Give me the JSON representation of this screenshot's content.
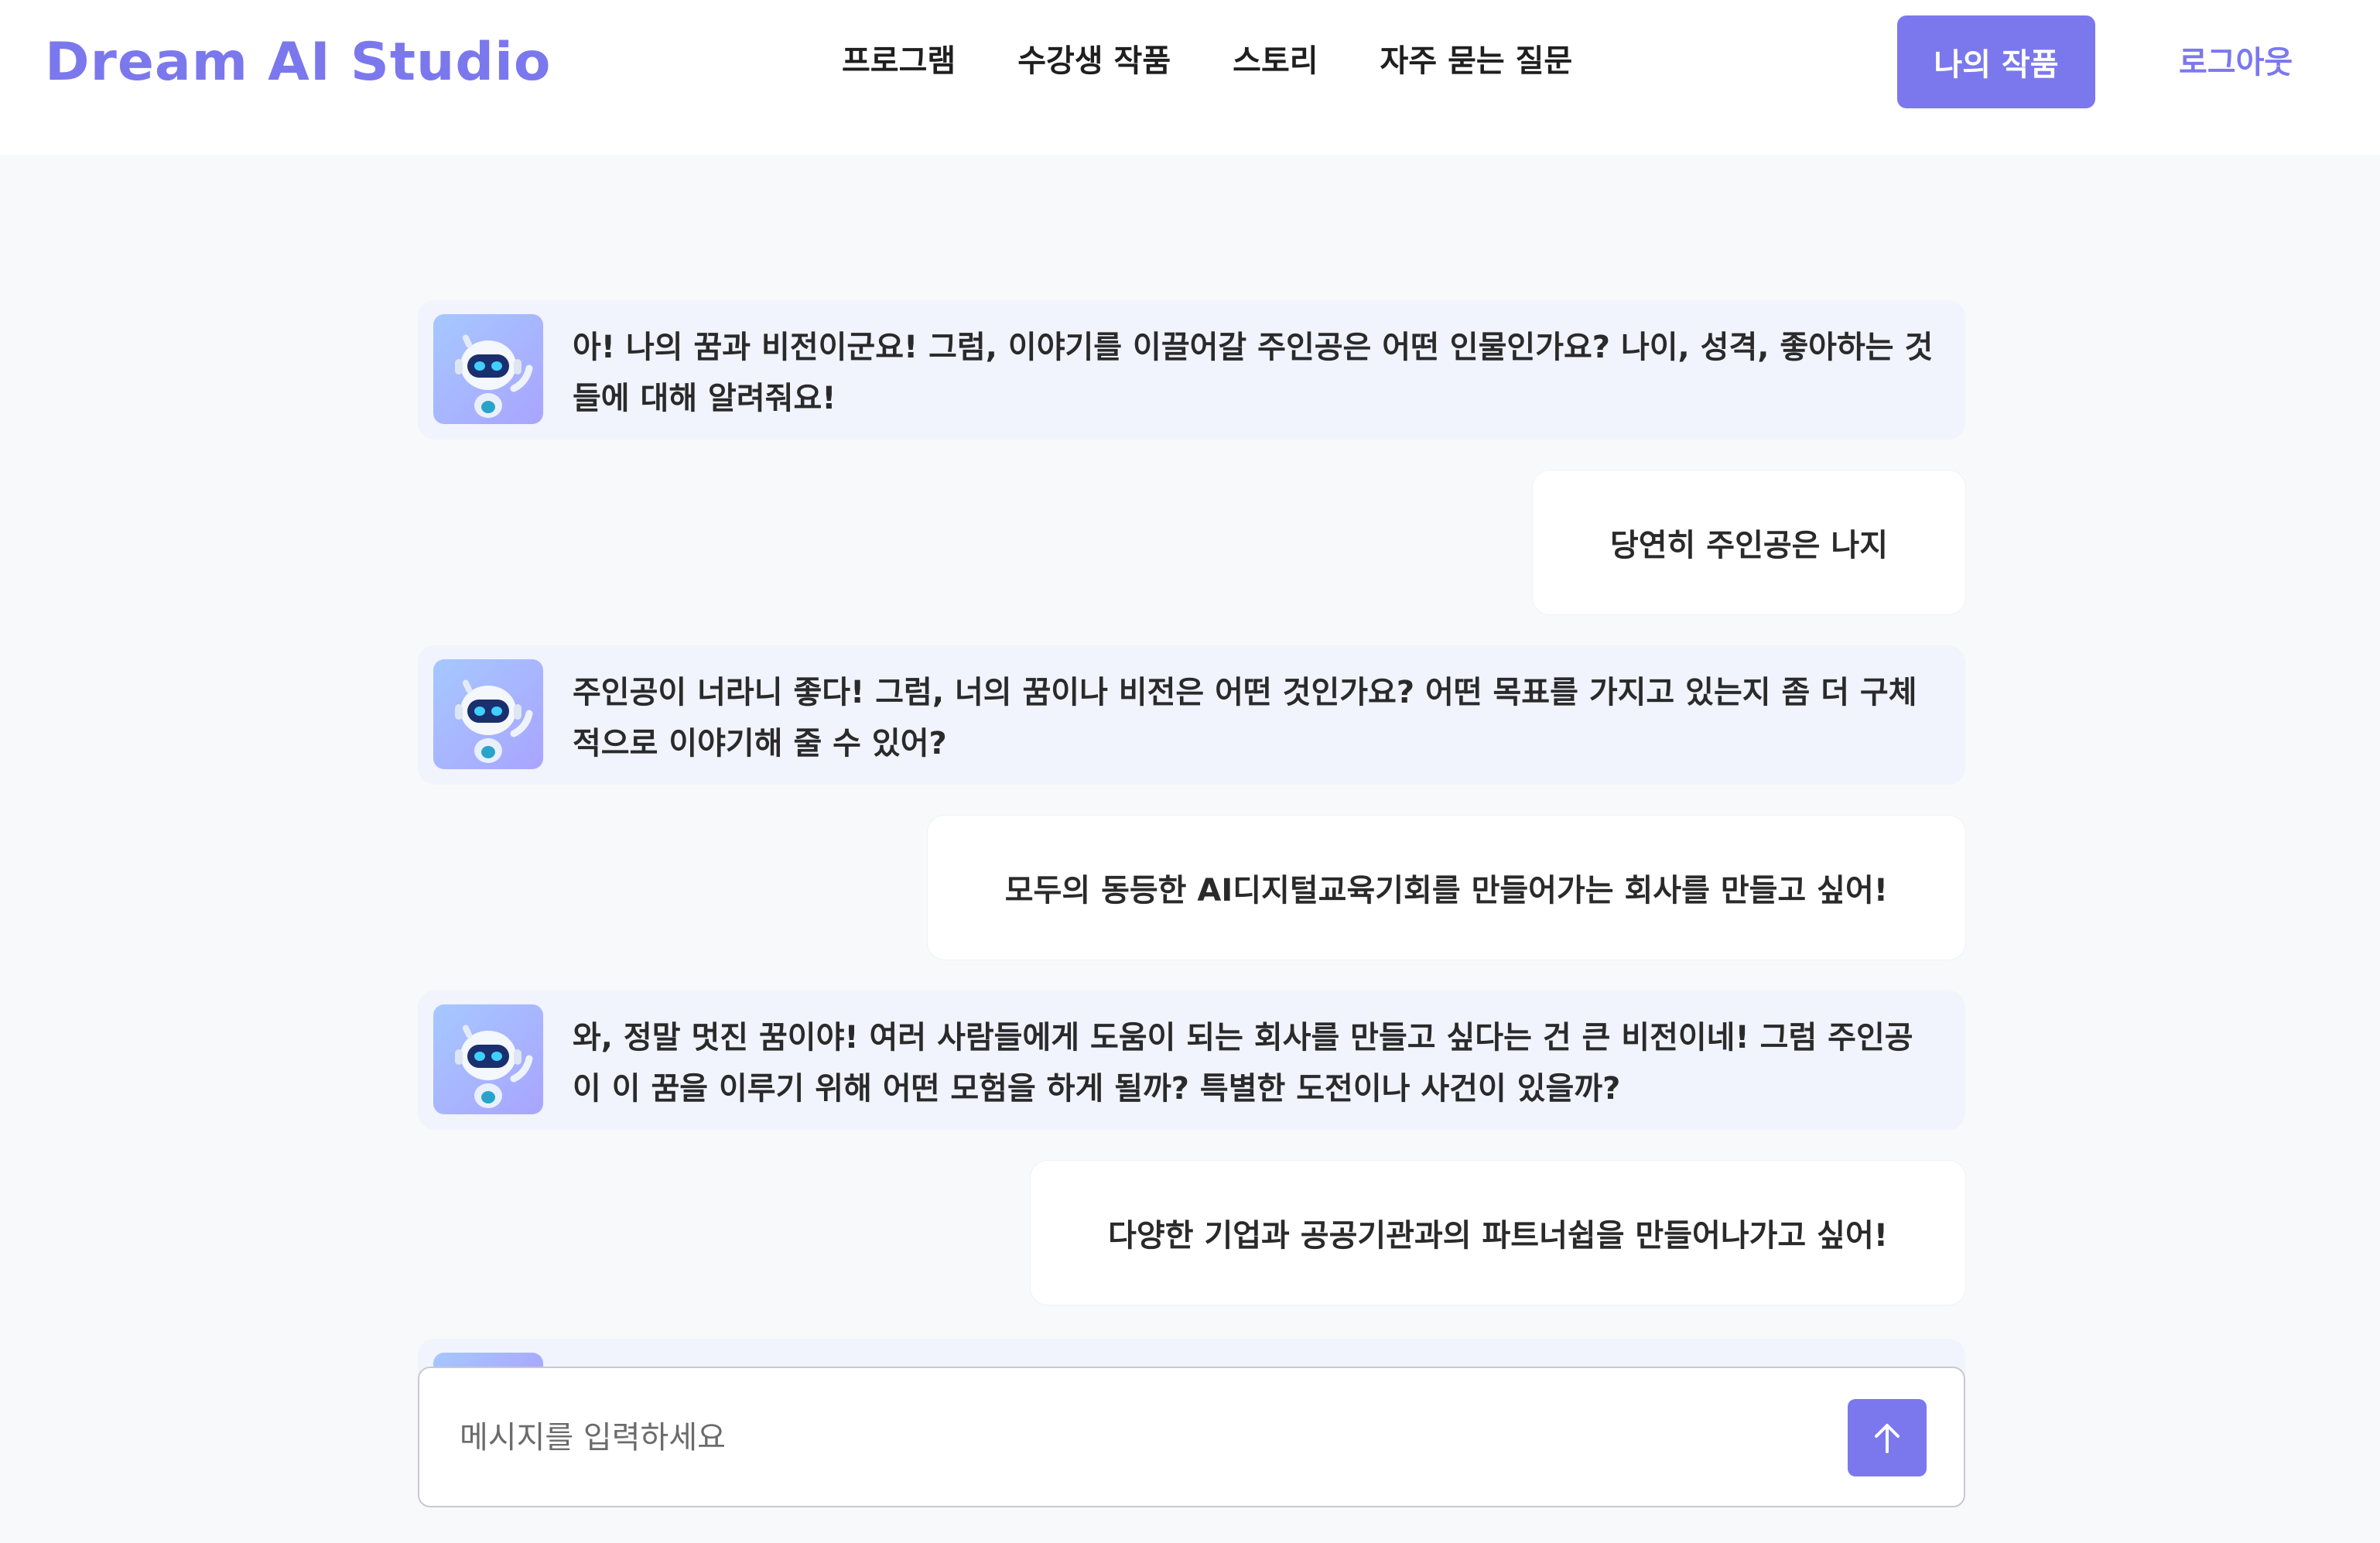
{
  "header": {
    "logo": "Dream AI Studio",
    "nav": [
      {
        "label": "프로그램"
      },
      {
        "label": "수강생 작품"
      },
      {
        "label": "스토리"
      },
      {
        "label": "자주 묻는 질문"
      }
    ],
    "my_works_label": "나의 작품",
    "logout_label": "로그아웃"
  },
  "chat": {
    "messages": [
      {
        "role": "bot",
        "text": "아! 나의 꿈과 비전이군요! 그럼, 이야기를 이끌어갈 주인공은 어떤 인물인가요? 나이, 성격, 좋아하는 것들에 대해 알려줘요!"
      },
      {
        "role": "user",
        "text": "당연히 주인공은 나지"
      },
      {
        "role": "bot",
        "text": "주인공이 너라니 좋다! 그럼, 너의 꿈이나 비전은 어떤 것인가요? 어떤 목표를 가지고 있는지 좀 더 구체적으로 이야기해 줄 수 있어?"
      },
      {
        "role": "user",
        "text": "모두의 동등한 AI디지털교육기회를 만들어가는 회사를 만들고 싶어!"
      },
      {
        "role": "bot",
        "text": "와, 정말 멋진 꿈이야! 여러 사람들에게 도움이 되는 회사를 만들고 싶다는 건 큰 비전이네! 그럼 주인공이 이 꿈을 이루기 위해 어떤 모험을 하게 될까? 특별한 도전이나 사건이 있을까?"
      },
      {
        "role": "user",
        "text": "다양한 기업과 공공기관과의 파트너쉽을 만들어나가고 싶어!"
      }
    ]
  },
  "input": {
    "placeholder": "메시지를 입력하세요",
    "value": ""
  },
  "icons": {
    "avatar": "robot-avatar-icon",
    "send": "arrow-up-icon"
  },
  "colors": {
    "accent": "#7b78ee",
    "bot_bubble": "#f1f3fd",
    "user_bubble": "#ffffff",
    "page_bg": "#f8f9fb"
  }
}
